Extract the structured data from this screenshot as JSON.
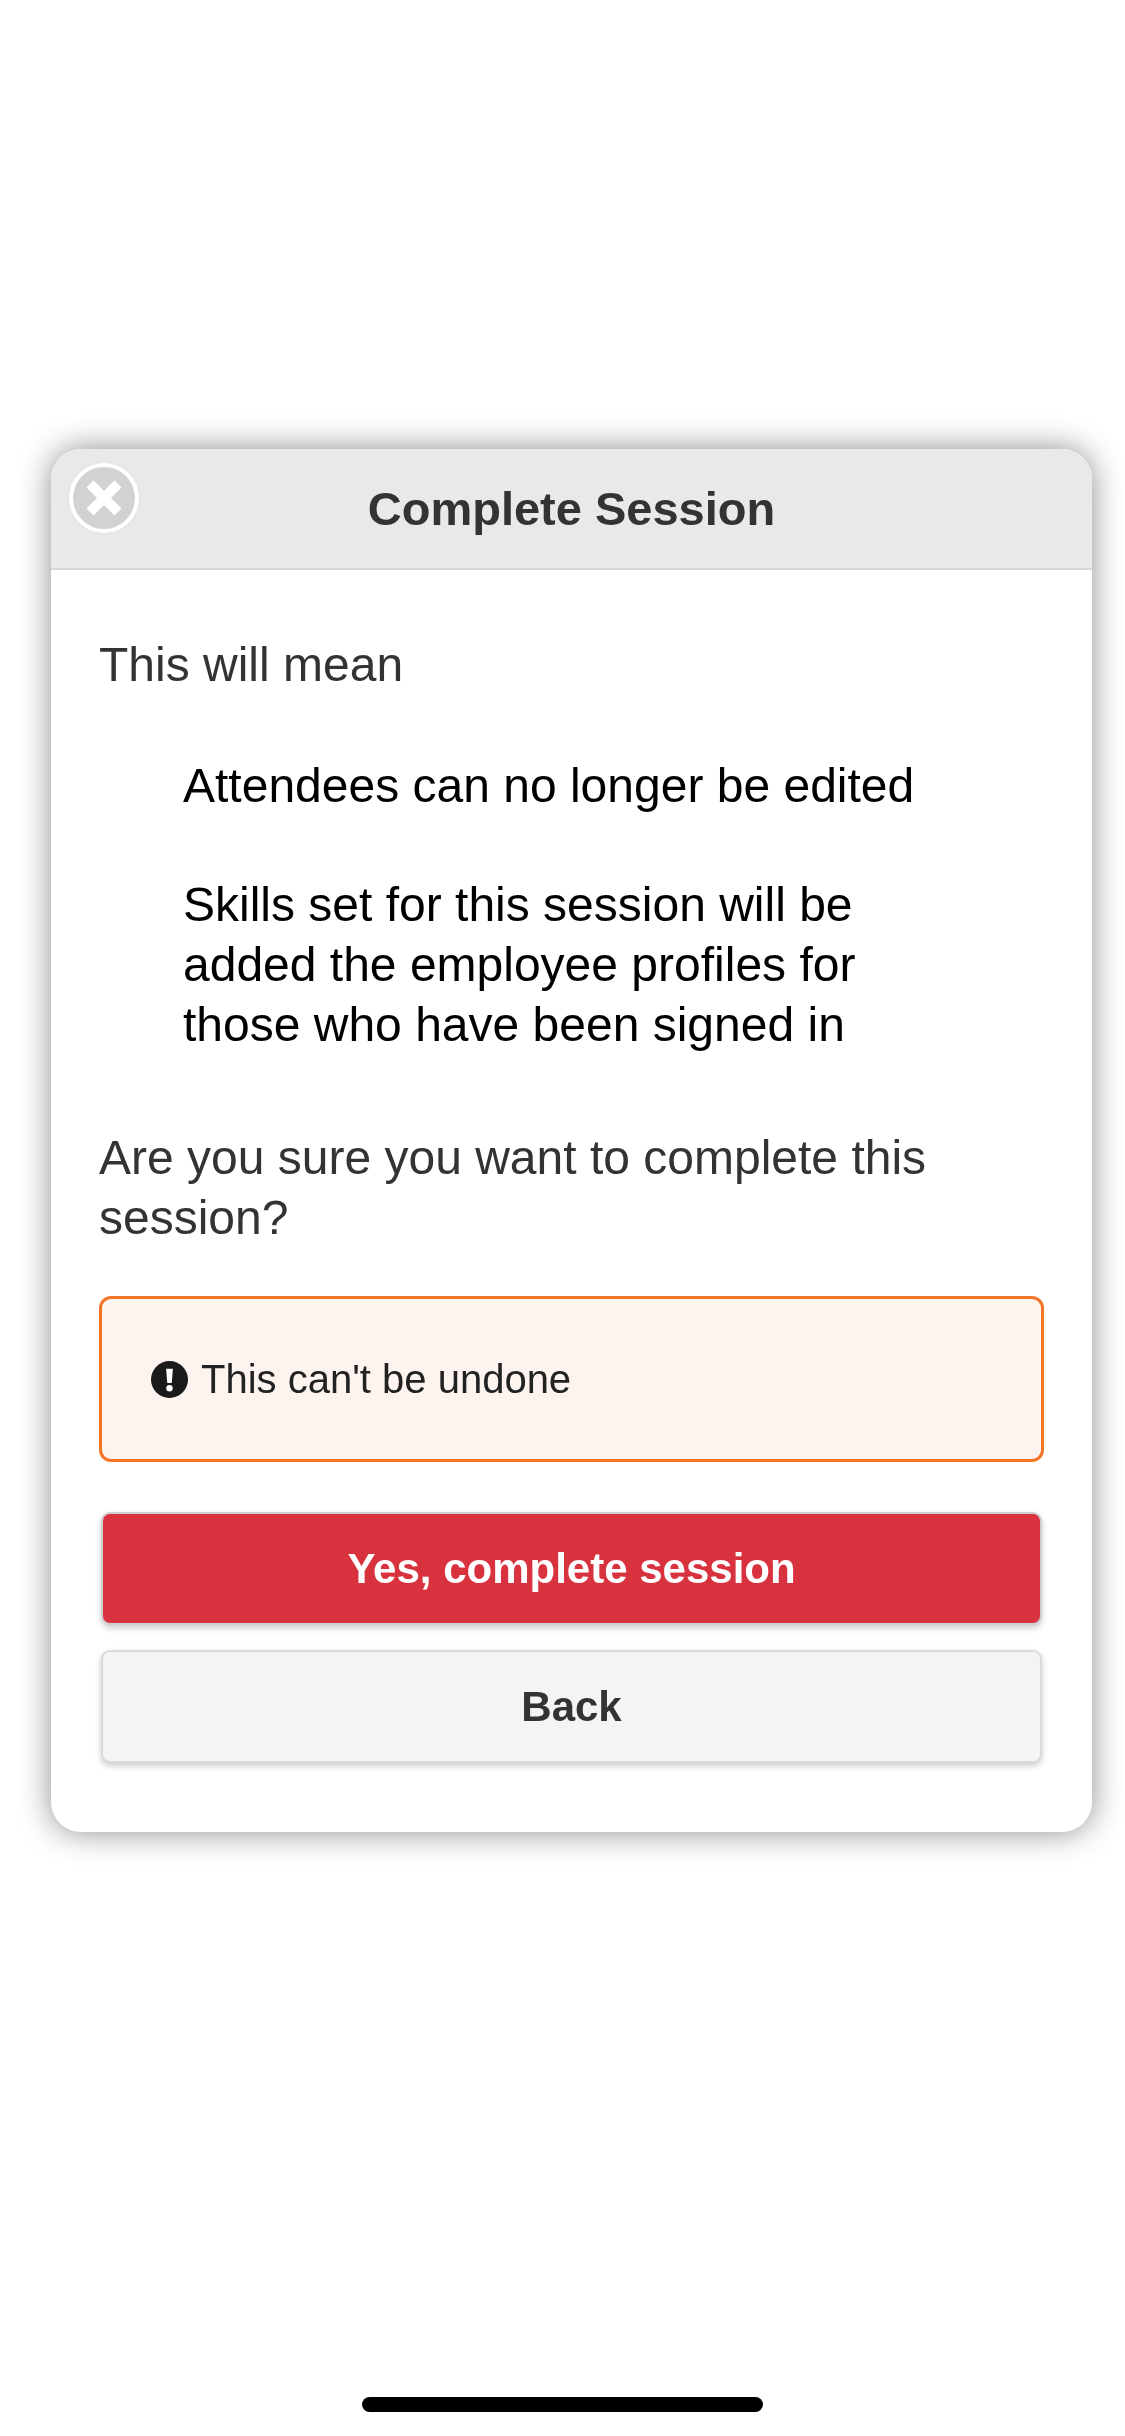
{
  "dialog": {
    "title": "Complete Session",
    "intro": "This will mean",
    "consequences": [
      "Attendees can no longer be edited",
      "Skills set for this session will be added the employee profiles for those who have been signed in"
    ],
    "question": "Are you sure you want to complete this session?",
    "warning": {
      "text": "This can't be undone"
    },
    "buttons": [
      {
        "label": "Yes, complete session",
        "kind": "primary"
      },
      {
        "label": "Back",
        "kind": "secondary"
      }
    ]
  }
}
